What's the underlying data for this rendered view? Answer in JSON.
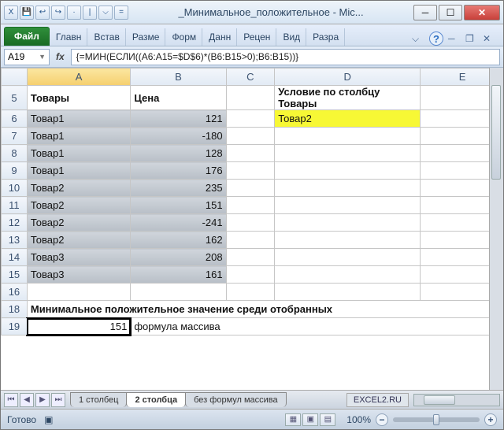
{
  "window": {
    "title": "_Минимальное_положительное - Mic..."
  },
  "qat": [
    "X",
    "💾",
    "↩",
    "↪",
    "·",
    "|",
    "⌵",
    "="
  ],
  "ribbon": {
    "file": "Файл",
    "tabs": [
      "Главн",
      "Встав",
      "Разме",
      "Форм",
      "Данн",
      "Рецен",
      "Вид",
      "Разра"
    ]
  },
  "namebox": "A19",
  "formula": "{=МИН(ЕСЛИ((A6:A15=$D$6)*(B6:B15>0);B6:B15))}",
  "columns": [
    "A",
    "B",
    "C",
    "D",
    "E"
  ],
  "rows": {
    "5": {
      "A": "Товары",
      "B": "Цена",
      "D": "Условие по столбцу Товары"
    },
    "6": {
      "A": "Товар1",
      "B": "121",
      "D": "Товар2"
    },
    "7": {
      "A": "Товар1",
      "B": "-180"
    },
    "8": {
      "A": "Товар1",
      "B": "128"
    },
    "9": {
      "A": "Товар1",
      "B": "176"
    },
    "10": {
      "A": "Товар2",
      "B": "235"
    },
    "11": {
      "A": "Товар2",
      "B": "151"
    },
    "12": {
      "A": "Товар2",
      "B": "-241"
    },
    "13": {
      "A": "Товар2",
      "B": "162"
    },
    "14": {
      "A": "Товар3",
      "B": "208"
    },
    "15": {
      "A": "Товар3",
      "B": "161"
    },
    "16": {},
    "18": {
      "A": "Минимальное положительное значение среди отобранных"
    },
    "19": {
      "A": "151",
      "B": "формула массива"
    }
  },
  "sheets": {
    "tabs": [
      "1 столбец",
      "2 столбца",
      "без формул массива"
    ],
    "active": 1,
    "brand": "EXCEL2.RU"
  },
  "status": {
    "ready": "Готово",
    "zoom": "100%"
  },
  "zoom_controls": {
    "minus": "−",
    "plus": "+"
  }
}
